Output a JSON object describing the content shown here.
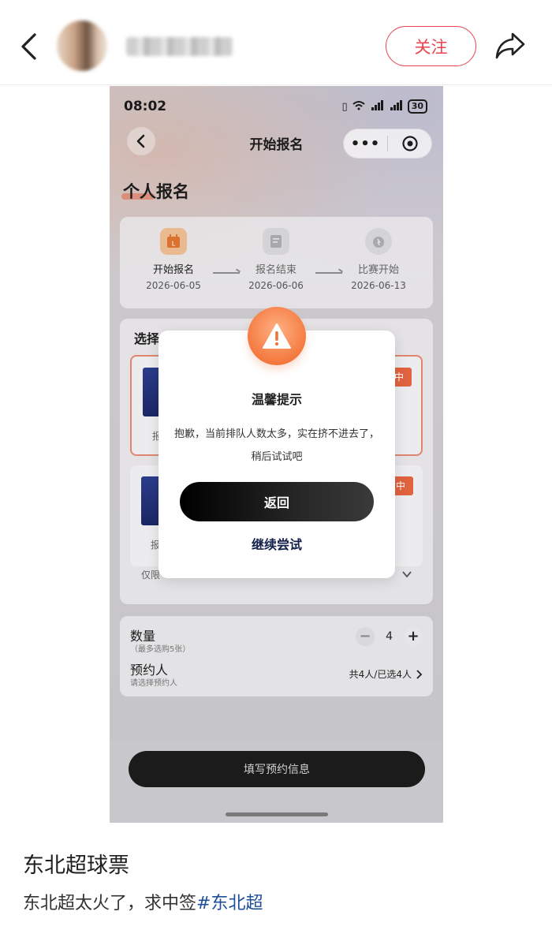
{
  "header": {
    "follow_label": "关注"
  },
  "screenshot": {
    "status_time": "08:02",
    "battery": "30",
    "nav_title": "开始报名",
    "capsule_more": "•••",
    "section_title": "个人报名",
    "steps": [
      {
        "label": "开始报名",
        "date": "2026-06-05"
      },
      {
        "label": "报名结束",
        "date": "2026-06-06"
      },
      {
        "label": "比赛开始",
        "date": "2026-06-13"
      }
    ],
    "select_title": "选择",
    "tickets": [
      {
        "tag": "中",
        "small": "报名"
      },
      {
        "tag": "中",
        "small": "报名"
      }
    ],
    "limit_text": "仅限",
    "quantity": {
      "title": "数量",
      "sub": "（最多选购5张）",
      "value": "4",
      "minus": "−",
      "plus": "+"
    },
    "reservation": {
      "title": "预约人",
      "sub": "请选择预约人",
      "value": "共4人/已选4人"
    },
    "fill_button": "填写预约信息",
    "dialog": {
      "title": "温馨提示",
      "message": "抱歉，当前排队人数太多，实在挤不进去了，稍后试试吧",
      "primary": "返回",
      "secondary": "继续尝试"
    }
  },
  "post": {
    "title": "东北超球票",
    "body": "东北超太火了，求中签",
    "hashtag": "#东北超"
  },
  "colors": {
    "accent": "#e8434f",
    "warning": "#f4793f",
    "hashtag": "#1f4e9a"
  }
}
